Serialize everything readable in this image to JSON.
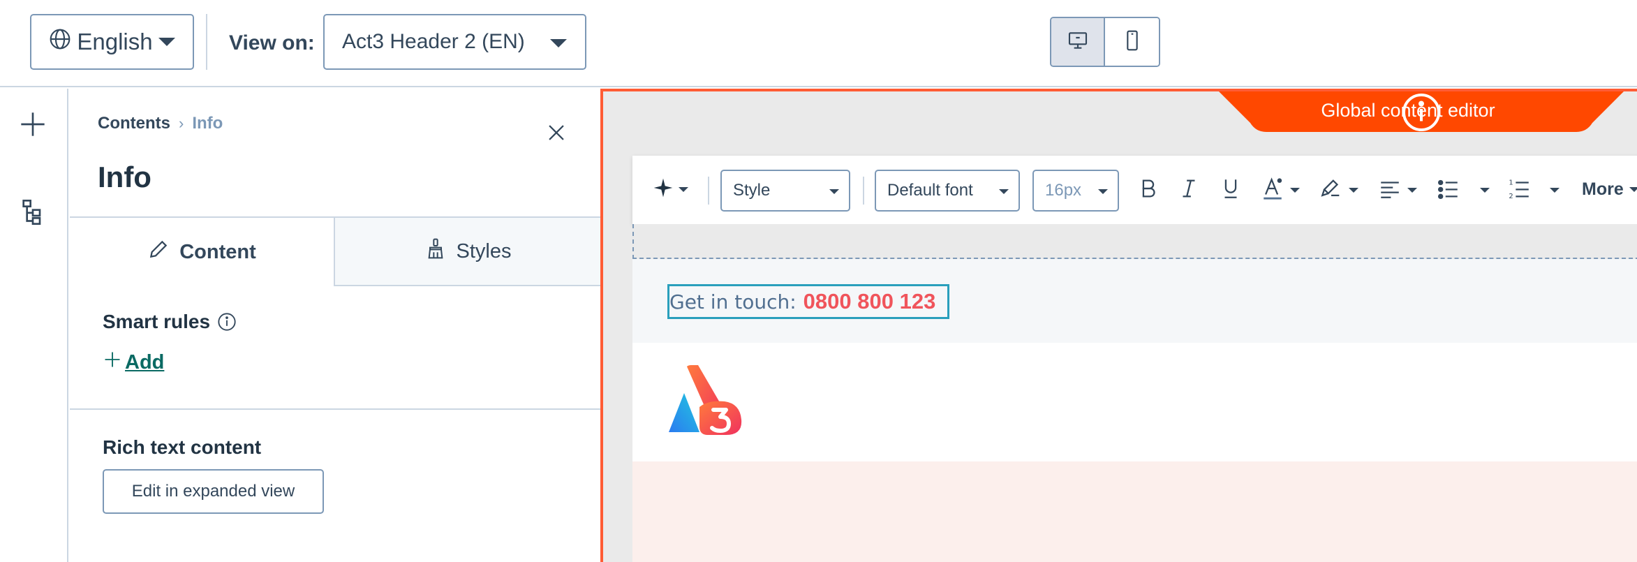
{
  "topbar": {
    "language": "English",
    "view_on_label": "View on:",
    "view_on_value": "Act3 Header 2 (EN)",
    "device_desktop_active": true
  },
  "panel": {
    "breadcrumb_parent": "Contents",
    "breadcrumb_separator": "›",
    "breadcrumb_current": "Info",
    "title": "Info",
    "tabs": [
      {
        "label": "Content",
        "active": true
      },
      {
        "label": "Styles",
        "active": false
      }
    ],
    "smart_rules_label": "Smart rules",
    "add_label": "Add",
    "rich_text_label": "Rich text content",
    "expand_button_label": "Edit in expanded view"
  },
  "canvas": {
    "global_editor_label": "Global content editor",
    "toolbar": {
      "style_select": "Style",
      "font_select": "Default font",
      "size_select": "16px",
      "more_label": "More"
    },
    "contact_prefix": "Get in touch:",
    "contact_number": "0800 800 123"
  },
  "colors": {
    "accent_orange": "#ff5c35",
    "link_teal": "#0a6a63",
    "selection_blue": "#2a9fbc",
    "phone_red": "#f0545b",
    "text_dark": "#33475b"
  },
  "icons": [
    "globe-icon",
    "desktop-icon",
    "mobile-icon",
    "plus-icon",
    "tree-icon",
    "close-icon",
    "pencil-icon",
    "brush-icon",
    "info-icon",
    "ai-sparkle-icon",
    "bold-icon",
    "italic-icon",
    "underline-icon",
    "text-color-icon",
    "highlight-icon",
    "align-icon",
    "bullet-list-icon",
    "numbered-list-icon"
  ]
}
